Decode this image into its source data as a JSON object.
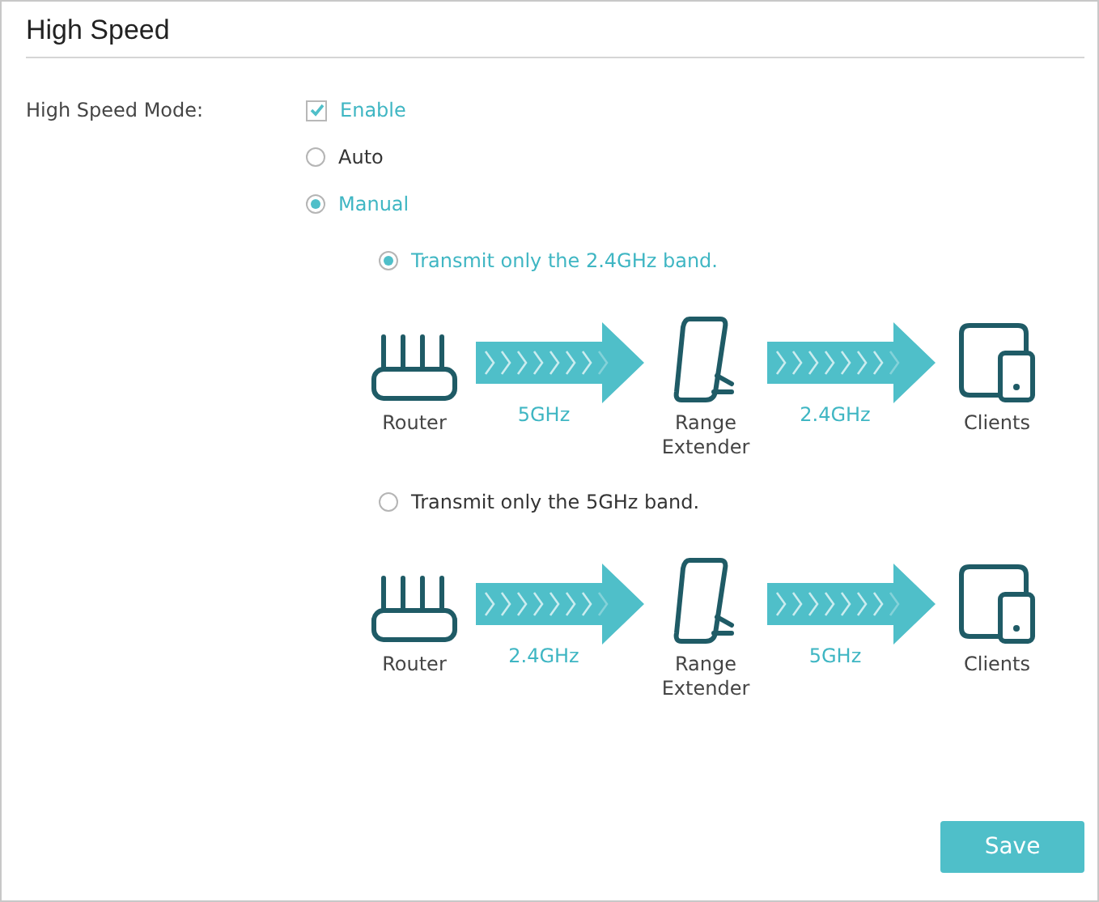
{
  "title": "High Speed",
  "mode": {
    "label": "High Speed Mode:",
    "enable": {
      "label": "Enable",
      "checked": true
    },
    "options": [
      {
        "label": "Auto",
        "selected": false
      },
      {
        "label": "Manual",
        "selected": true
      }
    ]
  },
  "bands": [
    {
      "label": "Transmit only the 2.4GHz band.",
      "selected": true,
      "nodes": [
        {
          "kind": "router",
          "label": "Router"
        },
        {
          "kind": "extender",
          "label": "Range Extender"
        },
        {
          "kind": "clients",
          "label": "Clients"
        }
      ],
      "links": [
        "5GHz",
        "2.4GHz"
      ]
    },
    {
      "label": "Transmit only the 5GHz band.",
      "selected": false,
      "nodes": [
        {
          "kind": "router",
          "label": "Router"
        },
        {
          "kind": "extender",
          "label": "Range Extender"
        },
        {
          "kind": "clients",
          "label": "Clients"
        }
      ],
      "links": [
        "2.4GHz",
        "5GHz"
      ]
    }
  ],
  "save": "Save"
}
